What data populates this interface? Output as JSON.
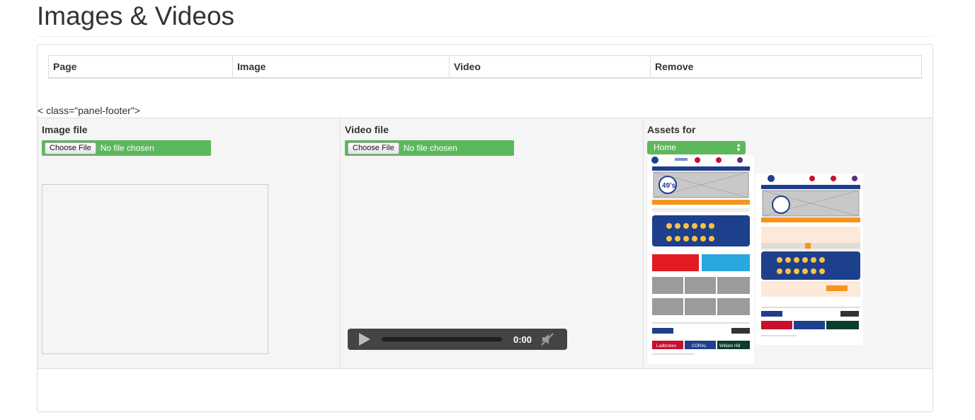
{
  "page": {
    "title": "Images & Videos",
    "stray_text": "< class=\"panel-footer\">"
  },
  "table": {
    "headers": [
      "Page",
      "Image",
      "Video",
      "Remove"
    ]
  },
  "image_upload": {
    "label": "Image file",
    "button_label": "Choose File",
    "status": "No file chosen"
  },
  "video_upload": {
    "label": "Video file",
    "button_label": "Choose File",
    "status": "No file chosen",
    "player_time": "0:00"
  },
  "assets": {
    "label": "Assets for",
    "selected_page": "Home"
  },
  "thumbnails": {
    "brand_text": "49's",
    "partner_1": "Ladbrokes",
    "partner_2": "CORAL",
    "partner_3": "William Hill"
  },
  "colors": {
    "accent_green": "#5cb85c",
    "nav_blue": "#1d3f8c",
    "orange": "#f7941d"
  }
}
